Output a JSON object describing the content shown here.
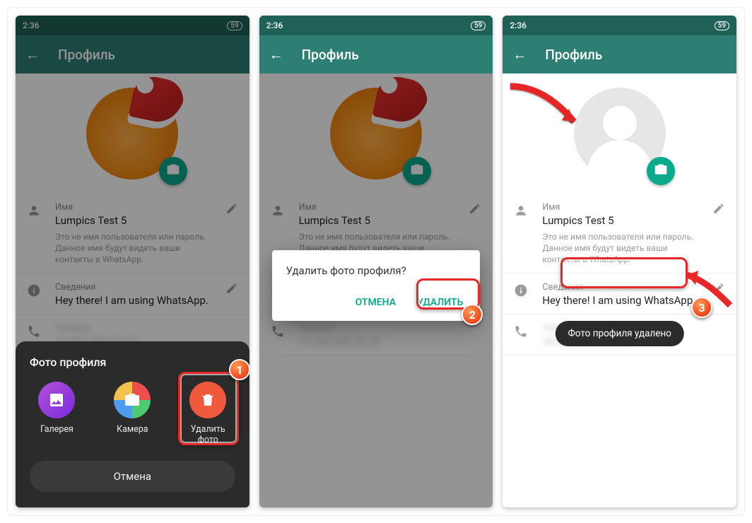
{
  "status": {
    "time": "2:36",
    "battery": "59"
  },
  "appbar": {
    "title": "Профиль"
  },
  "profile": {
    "name_label": "Имя",
    "name_value": "Lumpics Test 5",
    "name_hint": "Это не имя пользователя или пароль. Данное имя будут видеть ваши контакты в WhatsApp.",
    "about_label": "Сведения",
    "about_value": "Hey there! I am using WhatsApp."
  },
  "sheet": {
    "title": "Фото профиля",
    "gallery": "Галерея",
    "camera": "Камера",
    "delete": "Удалить фото",
    "cancel": "Отмена"
  },
  "dialog": {
    "message": "Удалить фото профиля?",
    "cancel": "ОТМЕНА",
    "confirm": "УДАЛИТЬ"
  },
  "toast": {
    "text": "Фото профиля удалено"
  },
  "badges": {
    "one": "1",
    "two": "2",
    "three": "3"
  }
}
